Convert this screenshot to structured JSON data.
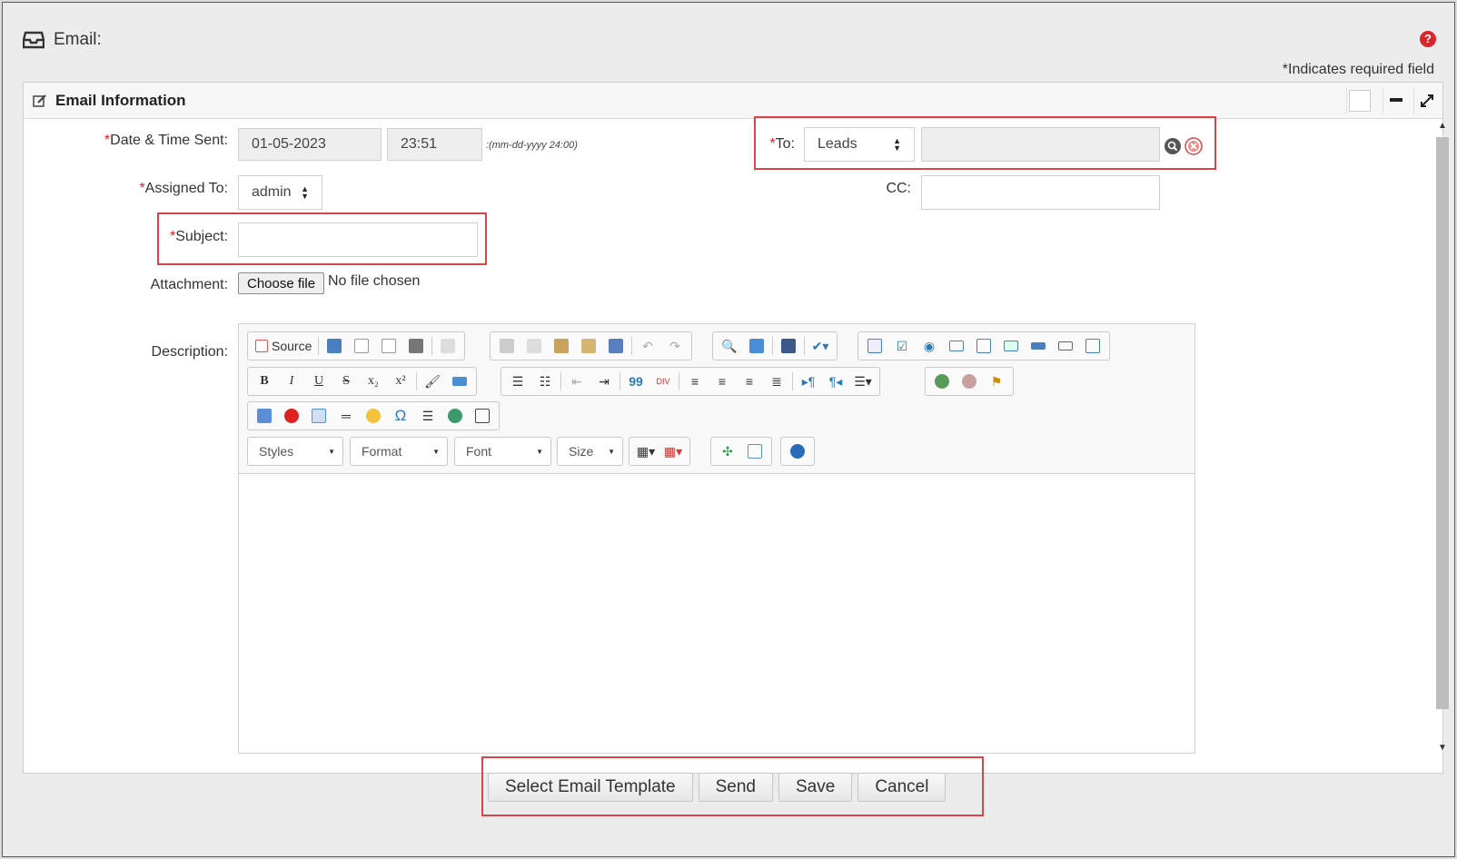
{
  "header": {
    "title": "Email:",
    "required_note": "*Indicates required field"
  },
  "panel": {
    "title": "Email Information"
  },
  "form": {
    "date_time": {
      "label": "Date & Time Sent:",
      "required": "*",
      "date_value": "01-05-2023",
      "time_value": "23:51",
      "format_hint": ":(mm-dd-yyyy 24:00)"
    },
    "assigned_to": {
      "label": "Assigned To:",
      "required": "*",
      "value": "admin"
    },
    "subject": {
      "label": "Subject:",
      "required": "*",
      "value": ""
    },
    "attachment": {
      "label": "Attachment:",
      "button": "Choose file",
      "status": "No file chosen"
    },
    "to": {
      "label": "To:",
      "required": "*",
      "module": "Leads",
      "value": ""
    },
    "cc": {
      "label": "CC:",
      "value": ""
    },
    "description": {
      "label": "Description:"
    }
  },
  "editor": {
    "source_label": "Source",
    "combos": {
      "styles": "Styles",
      "format": "Format",
      "font": "Font",
      "size": "Size"
    },
    "bold": "B",
    "italic": "I",
    "underline": "U",
    "strike": "S",
    "subscript": "x₂",
    "superscript": "x²",
    "quote": "99",
    "omega": "Ω"
  },
  "footer": {
    "select_template": "Select Email Template",
    "send": "Send",
    "save": "Save",
    "cancel": "Cancel"
  },
  "colors": {
    "highlight": "#d9454a",
    "required": "#d9262c"
  }
}
